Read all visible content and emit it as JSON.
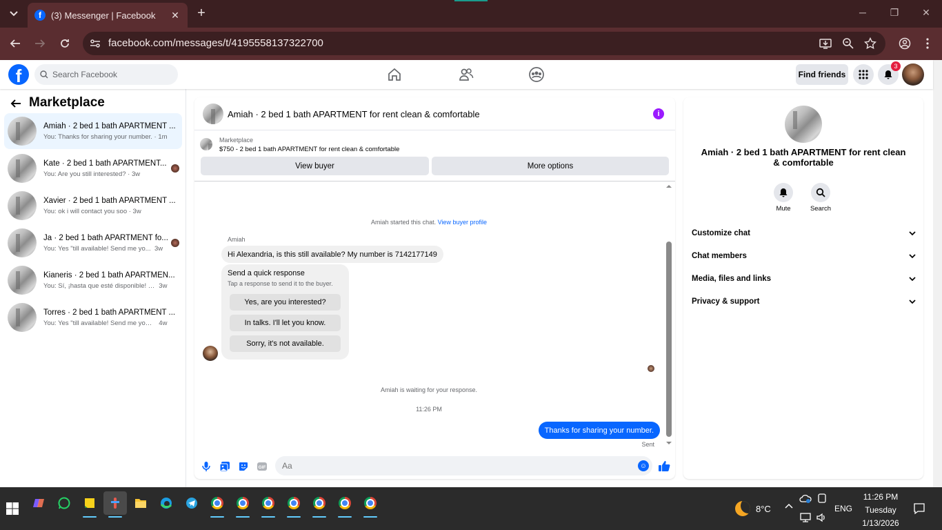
{
  "browser": {
    "tab_title": "(3) Messenger | Facebook",
    "url": "facebook.com/messages/t/4195558137322700"
  },
  "fb": {
    "search_placeholder": "Search Facebook",
    "find_friends": "Find friends",
    "notification_count": "3"
  },
  "sidebar": {
    "title": "Marketplace",
    "threads": [
      {
        "name": "Amiah · 2 bed 1 bath APARTMENT ...",
        "preview": "You: Thanks for sharing your number.",
        "time": "· 1m",
        "active": true
      },
      {
        "name": "Kate · 2 bed 1 bath APARTMENT...",
        "preview": "You: Are you still interested?",
        "time": "· 3w"
      },
      {
        "name": "Xavier · 2 bed 1 bath APARTMENT ...",
        "preview": "You: ok i will contact you soo",
        "time": "· 3w"
      },
      {
        "name": "Ja · 2 bed 1 bath APARTMENT fo...",
        "preview": "You: Yes \"till available! Send me yo...",
        "time": "3w"
      },
      {
        "name": "Kianeris · 2 bed 1 bath APARTMEN...",
        "preview": "You: Sí, ¡hasta que esté disponible! En...",
        "time": "3w"
      },
      {
        "name": "Torres · 2 bed 1 bath APARTMENT ...",
        "preview": "You: Yes \"till available! Send me your ...",
        "time": "4w"
      }
    ]
  },
  "chat": {
    "title": "Amiah · 2 bed 1 bath APARTMENT for rent clean & comfortable",
    "marketplace_label": "Marketplace",
    "listing": "$750 - 2 bed 1 bath APARTMENT for rent clean & comfortable",
    "view_buyer": "View buyer",
    "more_options": "More options",
    "started_text": "Amiah started this chat.",
    "view_buyer_profile": "View buyer profile",
    "sender": "Amiah",
    "incoming_message": "Hi Alexandria, is this still available? My number is 7142177149",
    "quick_title": "Send a quick response",
    "quick_subtitle": "Tap a response to send it to the buyer.",
    "quick_responses": [
      "Yes, are you interested?",
      "In talks. I'll let you know.",
      "Sorry, it's not available."
    ],
    "waiting_text": "Amiah is waiting for your response.",
    "timestamp": "11:26 PM",
    "outgoing_message": "Thanks for sharing your number.",
    "sent_label": "Sent",
    "input_placeholder": "Aa"
  },
  "info_panel": {
    "title": "Amiah · 2 bed 1 bath APARTMENT for rent clean & comfortable",
    "mute": "Mute",
    "search": "Search",
    "sections": [
      "Customize chat",
      "Chat members",
      "Media, files and links",
      "Privacy & support"
    ]
  },
  "taskbar": {
    "temperature": "8°C",
    "language": "ENG",
    "time": "11:26 PM",
    "day": "Tuesday",
    "date": "1/13/2026"
  },
  "colors": {
    "brand_blue": "#0866ff",
    "chrome_frame": "#3b1f21",
    "chrome_toolbar": "#5a2d30"
  }
}
